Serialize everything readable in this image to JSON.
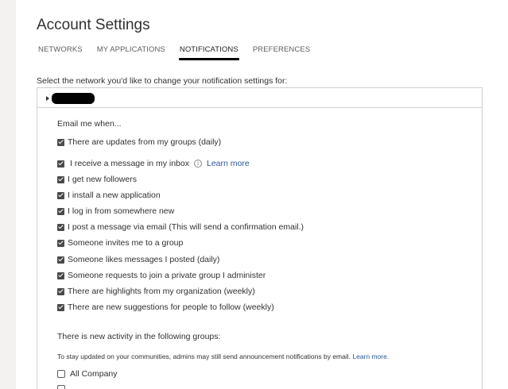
{
  "page": {
    "title": "Account Settings"
  },
  "tabs": [
    {
      "label": "NETWORKS",
      "active": false
    },
    {
      "label": "MY APPLICATIONS",
      "active": false
    },
    {
      "label": "NOTIFICATIONS",
      "active": true
    },
    {
      "label": "PREFERENCES",
      "active": false
    }
  ],
  "network_select": {
    "intro": "Select the network you'd like to change your notification settings for:"
  },
  "email": {
    "heading": "Email me when...",
    "options": [
      {
        "label": "There are updates from my groups (daily)",
        "checked": true
      },
      {
        "label": "I receive a message in my inbox",
        "checked": true,
        "info_icon": "info-icon",
        "link": "Learn more"
      },
      {
        "label": "I get new followers",
        "checked": true
      },
      {
        "label": "I install a new application",
        "checked": true
      },
      {
        "label": "I log in from somewhere new",
        "checked": true
      },
      {
        "label": "I post a message via email (This will send a confirmation email.)",
        "checked": true
      },
      {
        "label": "Someone invites me to a group",
        "checked": true
      },
      {
        "label": "Someone likes messages I posted (daily)",
        "checked": true
      },
      {
        "label": "Someone requests to join a private group I administer",
        "checked": true
      },
      {
        "label": "There are highlights from my organization (weekly)",
        "checked": true
      },
      {
        "label": "There are new suggestions for people to follow (weekly)",
        "checked": true
      }
    ]
  },
  "groups": {
    "heading": "There is new activity in the following groups:",
    "note": "To stay updated on your communities, admins may still send announcement notifications by email.",
    "note_link": "Learn more.",
    "items": [
      {
        "label": "All Company",
        "checked": false
      }
    ]
  },
  "colors": {
    "link": "#2b579a",
    "active_tab_underline": "#000000",
    "checkbox_checked": "#4a4a4a"
  }
}
